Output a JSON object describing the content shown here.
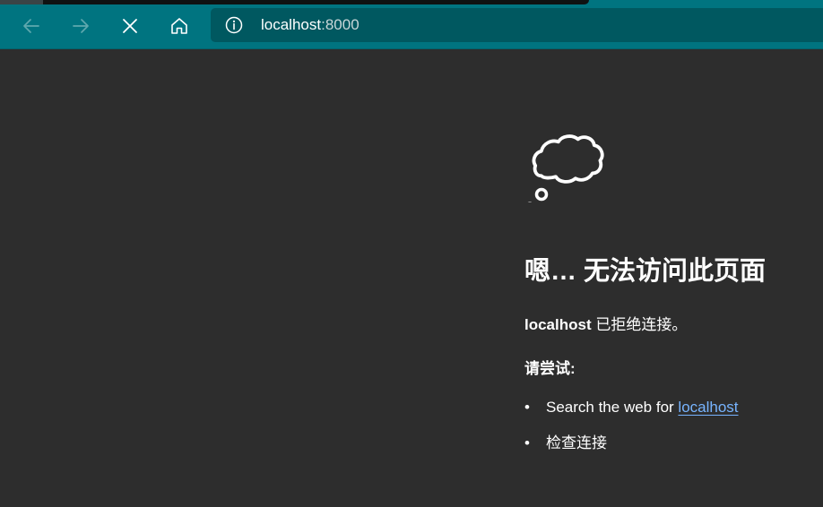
{
  "toolbar": {
    "back_icon": "arrow-left-icon",
    "forward_icon": "arrow-right-icon",
    "stop_icon": "close-icon",
    "home_icon": "home-icon"
  },
  "address_bar": {
    "info_icon": "info-icon",
    "host": "localhost",
    "port": ":8000"
  },
  "error_page": {
    "icon": "thought-cloud-icon",
    "title": "嗯… 无法访问此页面",
    "detail_host": "localhost",
    "detail_text": " 已拒绝连接。",
    "try_heading": "请尝试:",
    "suggestions": [
      {
        "bullet": "•",
        "prefix": "Search the web for ",
        "link": "localhost"
      },
      {
        "bullet": "•",
        "text": "检查连接"
      }
    ]
  },
  "colors": {
    "toolbar": "#007480",
    "address_bar": "#005860",
    "page_bg": "#2d2d2d",
    "link": "#77b4ff"
  }
}
